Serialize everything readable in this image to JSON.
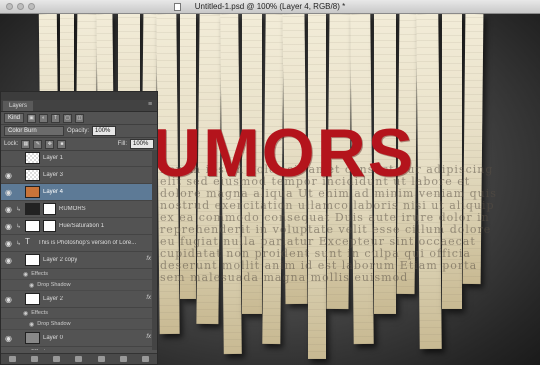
{
  "window": {
    "title": "Untitled-1.psd @ 100% (Layer 4, RGB/8) *"
  },
  "artwork": {
    "headline": "UMORS",
    "paper_text": "Lorem ipsum dolor sit amet consectetur adipiscing elit sed eiusmod tempor incididunt ut labore et dolore magna aliqua Ut enim ad minim veniam quis nostrud exercitation ullamco laboris nisi ut aliquip ex ea commodo consequat Duis aute irure dolor in reprehenderit in voluptate velit esse cillum dolore eu fugiat nulla pariatur Excepteur sint occaecat cupidatat non proident sunt in culpa qui officia deserunt mollit anim id est laborum Etiam porta sem malesuada magna mollis euismod"
  },
  "layers_panel": {
    "tab": "Layers",
    "filter": "Kind",
    "blend_mode": "Color Burn",
    "opacity_label": "Opacity:",
    "opacity_value": "100%",
    "lock_label": "Lock:",
    "fill_label": "Fill:",
    "fill_value": "100%",
    "layers": [
      {
        "name": "Layer 1",
        "visible": false,
        "thumb": "check"
      },
      {
        "name": "Layer 3",
        "visible": true,
        "thumb": "check"
      },
      {
        "name": "Layer 4",
        "visible": true,
        "thumb": "orange",
        "selected": true
      },
      {
        "name": "RUMORS",
        "visible": true,
        "thumb": "dark"
      },
      {
        "name": "Hue/Saturation 1",
        "visible": true,
        "thumb": "white"
      },
      {
        "name": "This is Photoshop's version  of Lore...",
        "visible": true,
        "thumb": "text"
      },
      {
        "name": "Layer 2 copy",
        "visible": true,
        "thumb": "white",
        "fx": "fx",
        "effects_label": "Effects",
        "effects": [
          "Drop Shadow"
        ]
      },
      {
        "name": "Layer 2",
        "visible": true,
        "thumb": "white",
        "fx": "fx",
        "effects_label": "Effects",
        "effects": [
          "Drop Shadow"
        ]
      },
      {
        "name": "Layer 0",
        "visible": true,
        "thumb": "gray",
        "fx": "fx",
        "effects_label": "Effects",
        "effects": [
          "Gradient Overlay"
        ]
      }
    ]
  }
}
